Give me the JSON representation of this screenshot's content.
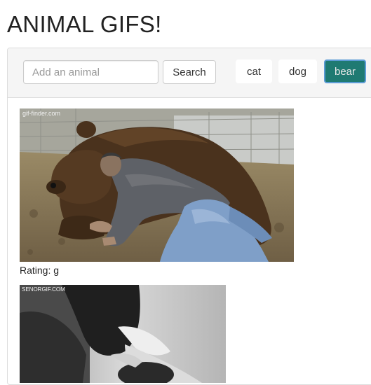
{
  "page": {
    "title": "ANIMAL GIFS!"
  },
  "search": {
    "placeholder": "Add an animal",
    "value": "",
    "button_label": "Search"
  },
  "tags": [
    {
      "label": "cat",
      "active": false
    },
    {
      "label": "dog",
      "active": false
    },
    {
      "label": "bear",
      "active": true
    }
  ],
  "results": [
    {
      "watermark": "gif-finder.com",
      "rating_text": "Rating: g"
    },
    {
      "watermark": "SENORGIF.COM"
    }
  ],
  "colors": {
    "active_tag_bg": "#1f7a72",
    "active_tag_border": "#5b9bd5",
    "panel_heading_bg": "#f5f5f5"
  }
}
